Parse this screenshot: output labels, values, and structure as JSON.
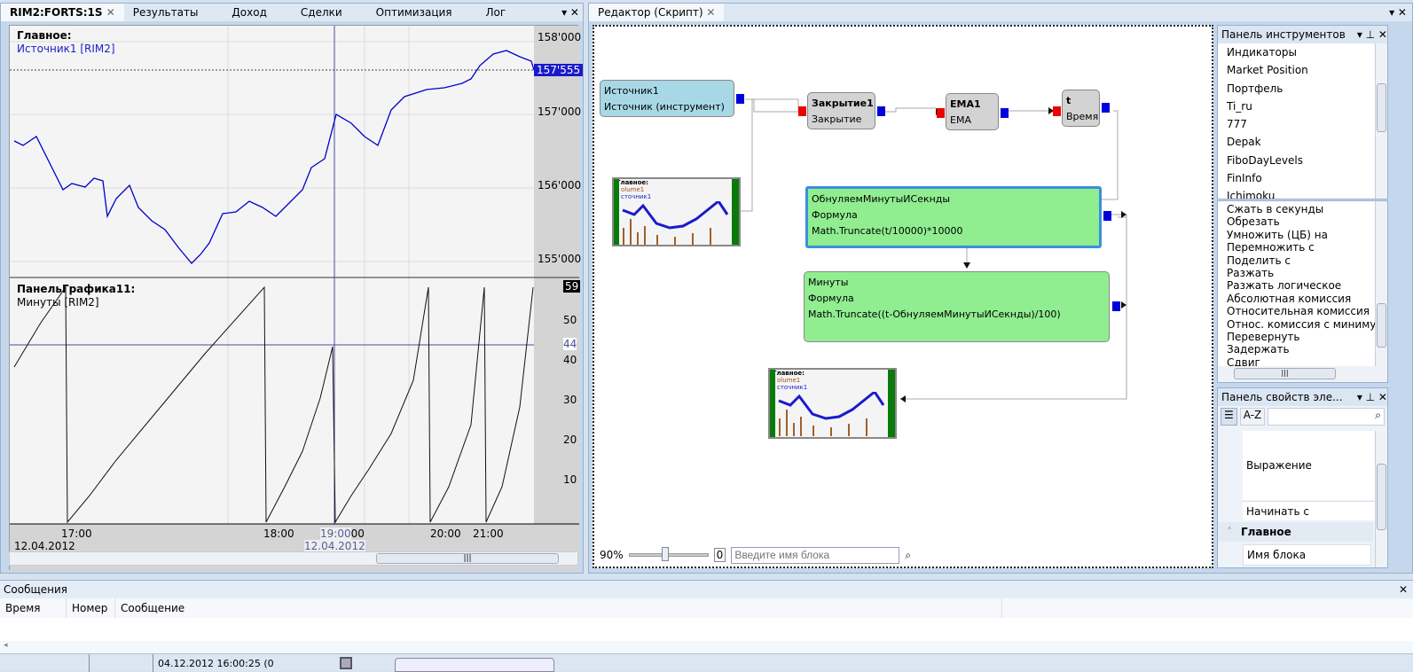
{
  "chart_window": {
    "tabs": [
      "RIM2:FORTS:1S",
      "Результаты",
      "Доход",
      "Сделки",
      "Оптимизация",
      "Лог"
    ],
    "main_pane": {
      "title": "Главное:",
      "series": "Источник1 [RIM2]",
      "price_ticks": [
        "158'000",
        "157'000",
        "156'000",
        "155'000"
      ],
      "last_price": "157'555"
    },
    "sub_pane": {
      "title": "ПанельГрафика11:",
      "series": "Минуты [RIM2]",
      "ticks": [
        "50",
        "40",
        "30",
        "20",
        "10"
      ],
      "last_value": "59",
      "cursor_value": "44"
    },
    "time_ticks": [
      "17:00",
      "18:00",
      "20:00",
      "21:00"
    ],
    "date": "12.04.2012",
    "cursor_time": "19:00",
    "cursor_time_suffix": "00",
    "cursor_date": "12.04.2012"
  },
  "editor": {
    "tab": "Редактор (Скрипт)",
    "zoom": "90%",
    "zoom_value": "0",
    "search_placeholder": "Введите имя блока",
    "nodes": {
      "source": {
        "name": "Источник1",
        "type": "Источник (инструмент)"
      },
      "close": {
        "name": "Закрытие1",
        "type": "Закрытие"
      },
      "ema": {
        "name": "EMA1",
        "type": "EMA"
      },
      "time": {
        "name": "t",
        "type": "Время"
      },
      "zero": {
        "name": "ОбнуляемМинутыИСекнды",
        "label": "Формула",
        "formula": "Math.Truncate(t/10000)*10000"
      },
      "minutes": {
        "name": "Минуты",
        "label": "Формула",
        "formula": "Math.Truncate((t-ОбнуляемМинутыИСекнды)/100)"
      },
      "chart_preview": {
        "title": "Главное:",
        "s1": "olume1",
        "s2": "сточник1"
      }
    }
  },
  "toolbox": {
    "title": "Панель инструментов",
    "items": [
      "Индикаторы",
      "Market Position",
      "Портфель",
      "Ti_ru",
      "777",
      "Depak",
      "FiboDayLevels",
      "FinInfo",
      "Ichimoku"
    ],
    "items2": [
      "Сжать в секунды",
      "Обрезать",
      "Умножить (ЦБ) на",
      "Перемножить с",
      "Поделить с",
      "Разжать",
      "Разжать логическое",
      "Абсолютная комиссия",
      "Относительная комиссия",
      "Относ. комиссия с миниму",
      "Перевернуть",
      "Задержать",
      "Сдвиг"
    ]
  },
  "properties": {
    "title": "Панель свойств эле...",
    "az": "A-Z",
    "rows": [
      "Выражение",
      "Начинать с"
    ],
    "category": "Главное",
    "row3": "Имя блока"
  },
  "messages": {
    "title": "Сообщения",
    "columns": [
      "Время",
      "Номер",
      "Сообщение"
    ]
  },
  "status": {
    "datetime": "04.12.2012 16:00:25 (0"
  }
}
